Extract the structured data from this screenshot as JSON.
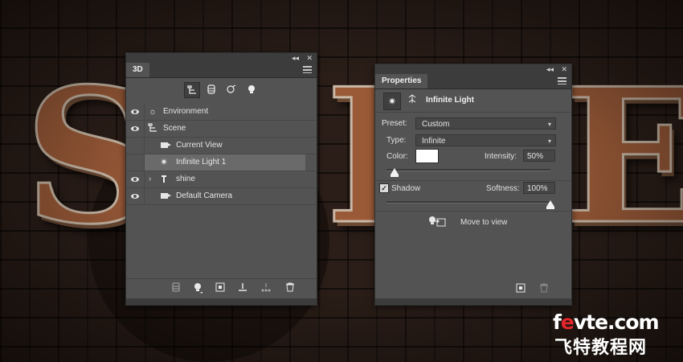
{
  "background": {
    "letters": [
      "S",
      "I",
      "E"
    ]
  },
  "panel3d": {
    "tab": "3D",
    "collapse_glyph": "◂◂",
    "close_glyph": "✕",
    "tools": [
      "scene-filter-icon",
      "mesh-filter-icon",
      "material-filter-icon",
      "light-filter-icon"
    ],
    "rows": [
      {
        "label": "Environment",
        "icon": "environment-icon",
        "visible": true
      },
      {
        "label": "Scene",
        "icon": "scene-icon",
        "visible": true
      },
      {
        "label": "Current View",
        "icon": "camera-icon",
        "visible": false
      },
      {
        "label": "Infinite Light 1",
        "icon": "infinite-light-icon",
        "visible": false,
        "selected": true
      },
      {
        "label": "shine",
        "icon": "mesh-icon",
        "visible": true,
        "collapsed": true
      },
      {
        "label": "Default Camera",
        "icon": "camera-icon",
        "visible": true
      }
    ],
    "bottom_tools": [
      "render-icon",
      "add-light-icon",
      "add-object-icon",
      "ground-icon",
      "mesh-options-icon",
      "trash-icon"
    ]
  },
  "properties": {
    "tab": "Properties",
    "collapse_glyph": "◂◂",
    "close_glyph": "✕",
    "title": "Infinite Light",
    "preset_label": "Preset:",
    "preset_value": "Custom",
    "type_label": "Type:",
    "type_value": "Infinite",
    "color_label": "Color:",
    "color_value": "#ffffff",
    "intensity_label": "Intensity:",
    "intensity_value": "50%",
    "intensity_fraction": 0.05,
    "shadow_label": "Shadow",
    "shadow_checked": true,
    "softness_label": "Softness:",
    "softness_value": "100%",
    "softness_fraction": 1.0,
    "move_to_view": "Move to view"
  },
  "watermark": {
    "line1_a": "f",
    "line1_b": "e",
    "line1_c": "vte.com",
    "line2": "飞特教程网"
  }
}
